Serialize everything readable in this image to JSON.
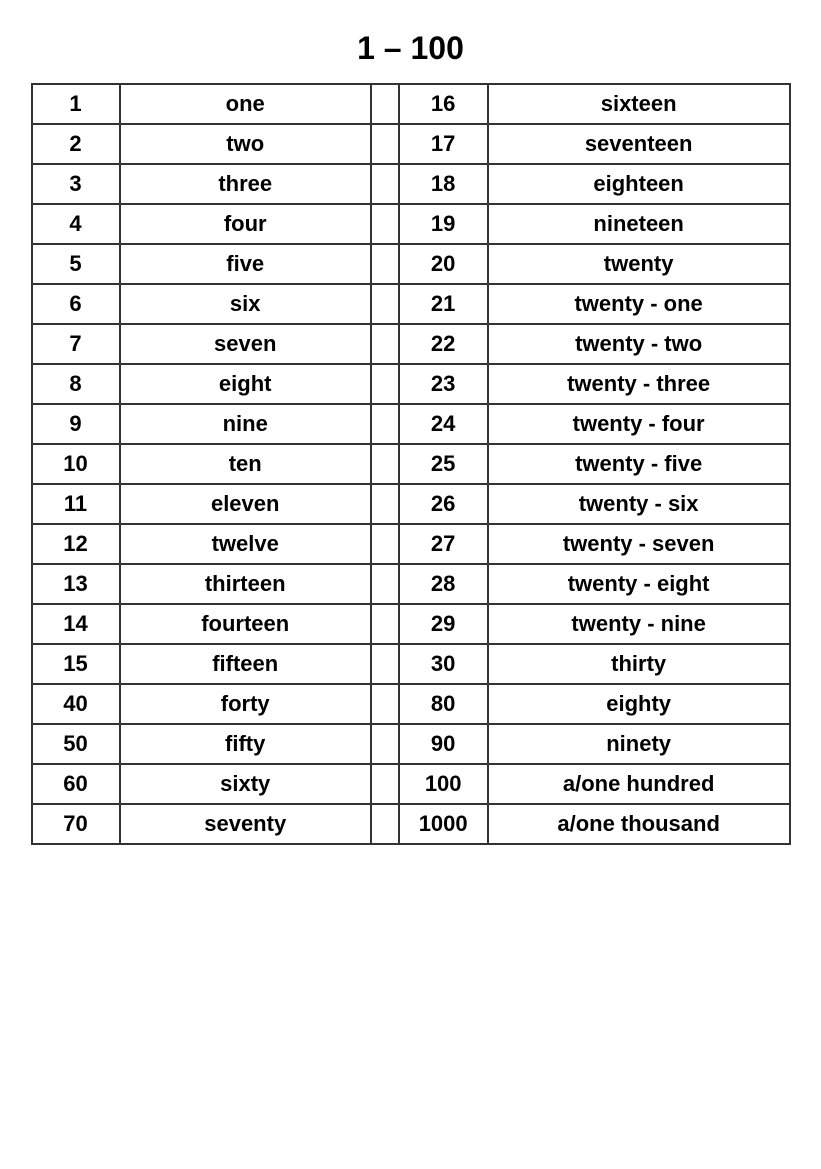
{
  "title": "1 – 100",
  "rows": [
    {
      "num1": "1",
      "word1": "one",
      "num2": "16",
      "word2": "sixteen"
    },
    {
      "num1": "2",
      "word1": "two",
      "num2": "17",
      "word2": "seventeen"
    },
    {
      "num1": "3",
      "word1": "three",
      "num2": "18",
      "word2": "eighteen"
    },
    {
      "num1": "4",
      "word1": "four",
      "num2": "19",
      "word2": "nineteen"
    },
    {
      "num1": "5",
      "word1": "five",
      "num2": "20",
      "word2": "twenty"
    },
    {
      "num1": "6",
      "word1": "six",
      "num2": "21",
      "word2": "twenty - one"
    },
    {
      "num1": "7",
      "word1": "seven",
      "num2": "22",
      "word2": "twenty - two"
    },
    {
      "num1": "8",
      "word1": "eight",
      "num2": "23",
      "word2": "twenty - three"
    },
    {
      "num1": "9",
      "word1": "nine",
      "num2": "24",
      "word2": "twenty - four"
    },
    {
      "num1": "10",
      "word1": "ten",
      "num2": "25",
      "word2": "twenty - five"
    },
    {
      "num1": "11",
      "word1": "eleven",
      "num2": "26",
      "word2": "twenty - six"
    },
    {
      "num1": "12",
      "word1": "twelve",
      "num2": "27",
      "word2": "twenty - seven"
    },
    {
      "num1": "13",
      "word1": "thirteen",
      "num2": "28",
      "word2": "twenty - eight"
    },
    {
      "num1": "14",
      "word1": "fourteen",
      "num2": "29",
      "word2": "twenty - nine"
    },
    {
      "num1": "15",
      "word1": "fifteen",
      "num2": "30",
      "word2": "thirty"
    },
    {
      "num1": "40",
      "word1": "forty",
      "num2": "80",
      "word2": "eighty"
    },
    {
      "num1": "50",
      "word1": "fifty",
      "num2": "90",
      "word2": "ninety"
    },
    {
      "num1": "60",
      "word1": "sixty",
      "num2": "100",
      "word2": "a/one hundred"
    },
    {
      "num1": "70",
      "word1": "seventy",
      "num2": "1000",
      "word2": "a/one thousand"
    }
  ]
}
